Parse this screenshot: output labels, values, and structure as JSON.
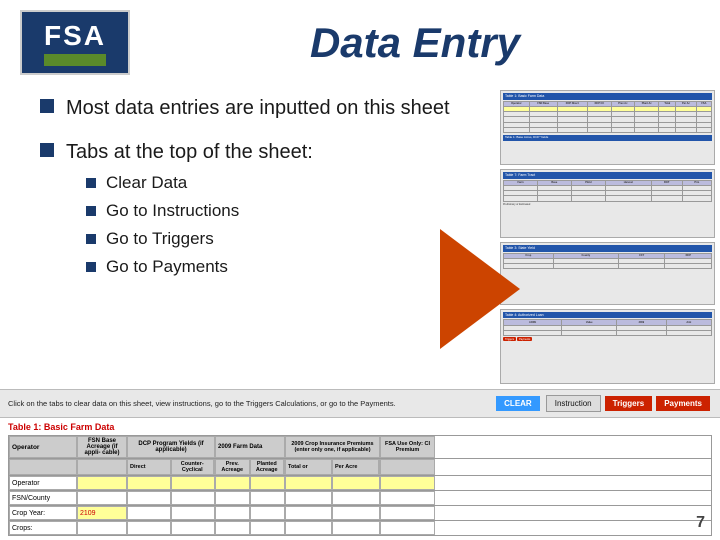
{
  "header": {
    "logo": "FSA",
    "title": "Data Entry"
  },
  "bullets": [
    {
      "id": 1,
      "text": "Most data entries are inputted on this sheet"
    },
    {
      "id": 2,
      "text": "Tabs at the top of the sheet:"
    }
  ],
  "sub_bullets": [
    {
      "id": 1,
      "text": "Clear Data"
    },
    {
      "id": 2,
      "text": "Go to Instructions"
    },
    {
      "id": 3,
      "text": "Go to Triggers"
    },
    {
      "id": 4,
      "text": "Go to Payments"
    }
  ],
  "bottom_bar": {
    "text": "Click on the tabs to clear data on this sheet, view instructions, go to the Triggers Calculations, or go to the Payments.",
    "btn_clear": "CLEAR",
    "btn_instruction": "Instruction",
    "btn_triggers": "Triggers",
    "btn_payments": "Payments"
  },
  "spreadsheet": {
    "table_label": "Table 1:",
    "table_title": "Basic Farm Data",
    "columns": {
      "col1": "Operator",
      "col2": "FSN Base Acreage (if appli- cable)",
      "col3_main": "DCP Program Yields (if applicable)",
      "col3a": "Direct",
      "col3b": "Counter- Cyclical",
      "col4_main": "2009 Farm Data",
      "col4a": "Prev. Acreage",
      "col4b": "Planted Acreage",
      "col5_main": "2009 Crop Insurance Premiums (enter only one, if applicable)",
      "col5a": "Total or",
      "col5b": "Per Acre",
      "col6_main": "FSA Use Only: CI Premium"
    },
    "rows": [
      {
        "col1": "Operator",
        "col2": "",
        "col3a": "",
        "col3b": "",
        "col4a": "",
        "col4b": "",
        "col5a": "",
        "col5b": "",
        "col6": ""
      },
      {
        "col1": "FSN/County",
        "col2": "",
        "col3a": "",
        "col3b": "",
        "col4a": "",
        "col4b": "",
        "col5a": "",
        "col5b": "",
        "col6": ""
      },
      {
        "col1": "Crop Year:",
        "col2": "2109",
        "col3a": "",
        "col3b": "",
        "col4a": "",
        "col4b": "",
        "col5a": "",
        "col5b": "",
        "col6": ""
      },
      {
        "col1": "Crops:",
        "col2": "",
        "col3a": "",
        "col3b": "",
        "col4a": "",
        "col4b": "",
        "col5a": "",
        "col5b": "",
        "col6": ""
      }
    ]
  },
  "page_number": "7",
  "per_acre_label": "Per Acre"
}
